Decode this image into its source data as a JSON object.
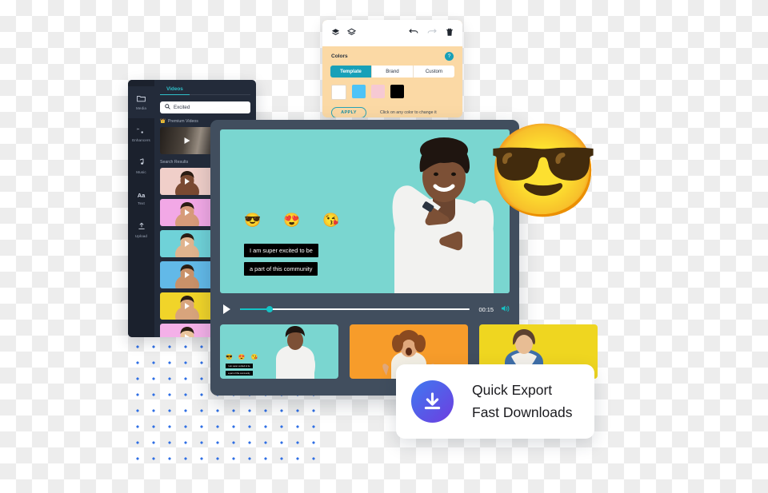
{
  "library": {
    "rail": [
      {
        "label": "Media",
        "icon": "folder-icon",
        "glyph": "☐"
      },
      {
        "label": "Enhancers",
        "icon": "enhancers-icon",
        "glyph": "⌘"
      },
      {
        "label": "Music",
        "icon": "music-note-icon",
        "glyph": "♪"
      },
      {
        "label": "Text",
        "icon": "text-icon",
        "glyph": "Aa"
      },
      {
        "label": "Upload",
        "icon": "upload-icon",
        "glyph": "⇧"
      }
    ],
    "tab": "Videos",
    "search": {
      "value": "Excited",
      "placeholder": "Search",
      "icon": "search-icon"
    },
    "premium_heading": "Premium Videos",
    "premium_crown": "👑",
    "results_heading": "Search Results",
    "premium_thumb_color": "#2b2622",
    "results": [
      {
        "bg": "#f0cfc9",
        "skin": "#7a4a32"
      },
      {
        "bg": "#f2a8e6",
        "skin": "#d79b7a"
      },
      {
        "bg": "#6fd2d8",
        "skin": "#e0b48e"
      },
      {
        "bg": "#62b9e8",
        "skin": "#c99169"
      },
      {
        "bg": "#f1d429",
        "skin": "#d8a47c"
      },
      {
        "bg": "#f4b0e8",
        "skin": "#e9c49c"
      }
    ]
  },
  "colors_panel": {
    "toolbar": {
      "layers_icon": "❖",
      "layers_alt_icon": "❇",
      "undo_icon": "↶",
      "redo_icon": "↷",
      "trash_icon": "🗑"
    },
    "label": "Colors",
    "help": "?",
    "tabs": [
      {
        "label": "Template",
        "active": true
      },
      {
        "label": "Brand",
        "active": false
      },
      {
        "label": "Custom",
        "active": false
      }
    ],
    "swatches": [
      "#ffffff",
      "#4ec3f7",
      "#f6c9d3",
      "#000000"
    ],
    "apply_label": "APPLY",
    "hint": "Click on any color to change it",
    "accent": "#18a0b8",
    "background": "#fbd9a5"
  },
  "editor": {
    "stage": {
      "background": "#7ad6d0",
      "emojis": [
        "😎",
        "😍",
        "😘"
      ],
      "caption_line1": "I am super excited to be",
      "caption_line2": "a part of this community"
    },
    "sticker_emoji": "😎",
    "controls": {
      "play_icon": "play-icon",
      "time": "00:15",
      "volume_icon": "🔊",
      "progress_percent": 13,
      "accent": "#15c4c6"
    },
    "timeline": [
      {
        "bg": "#7ad6d0",
        "selected": true,
        "emojis": [
          "😎",
          "😍",
          "😘"
        ],
        "cap1": "I am super excited to be",
        "cap2": "a part of this community"
      },
      {
        "bg": "#f79c2a",
        "selected": false
      },
      {
        "bg": "#efd620",
        "selected": false
      }
    ],
    "frame_color": "#414e5e"
  },
  "export_card": {
    "icon": "download-icon",
    "title": "Quick Export",
    "subtitle": "Fast Downloads",
    "gradient_from": "#3f79f0",
    "gradient_to": "#6e3de0"
  }
}
